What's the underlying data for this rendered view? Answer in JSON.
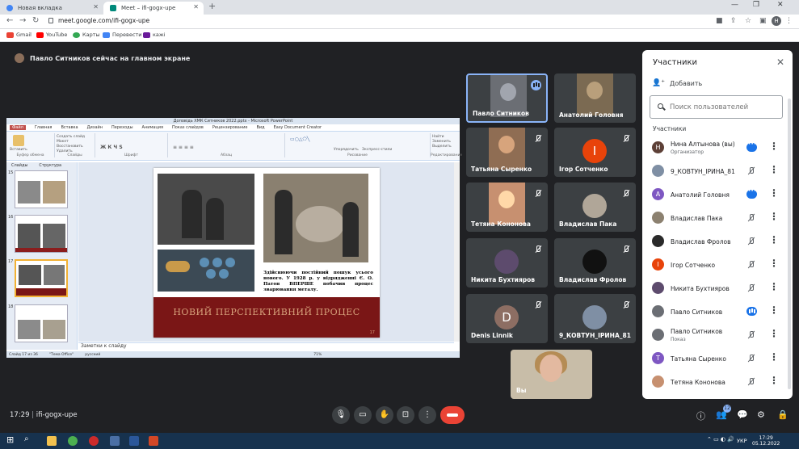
{
  "browser": {
    "tabs": [
      {
        "title": "Новая вкладка",
        "favicon_color": "#4285f4"
      },
      {
        "title": "Meet – ifi-gogx-upe",
        "favicon_color": "#00897b"
      }
    ],
    "new_tab": "+",
    "window": {
      "min": "—",
      "max": "❐",
      "close": "✕"
    },
    "url": "meet.google.com/ifi-gogx-upe",
    "profile_initial": "H",
    "bookmarks": [
      {
        "label": "Gmail",
        "color": "#ea4335"
      },
      {
        "label": "YouTube",
        "color": "#ff0000"
      },
      {
        "label": "Карты",
        "color": "#34a853"
      },
      {
        "label": "Перевести",
        "color": "#4285f4"
      },
      {
        "label": "кажі",
        "color": "#6a1b9a"
      }
    ]
  },
  "meet": {
    "banner": "Павло Ситников сейчас на главном экране",
    "tiles": [
      {
        "name": "Павло Ситников",
        "speaking": true,
        "img": "#6b6e74"
      },
      {
        "name": "Анатолий Головня",
        "img": "#7b6a52"
      },
      {
        "name": "Татьяна Сыренко",
        "img": "#8f6d53"
      },
      {
        "name": "Ігор Сотченко",
        "initial": "І",
        "color": "#e8430a"
      },
      {
        "name": "Тетяна Кононова",
        "img": "#c79070"
      },
      {
        "name": "Владислав Пака",
        "img": "#8c8170"
      },
      {
        "name": "Никита Бухтияров",
        "img": "#5d4b6d"
      },
      {
        "name": "Владислав Фролов",
        "img": "#2a2a2a"
      },
      {
        "name": "Denis Linnik",
        "initial": "D",
        "color": "#8d6e63"
      },
      {
        "name": "9_КОВТУН_ІРИНА_81",
        "img": "#7f8fa4"
      }
    ],
    "self_label": "Вы",
    "clock": "17:29",
    "meeting_code": "ifi-gogx-upe",
    "people_count": "12"
  },
  "ppt": {
    "title": "Доповідь ХМК Ситников 2022.pptx - Microsoft PowerPoint",
    "menu": [
      "Файл",
      "Главная",
      "Вставка",
      "Дизайн",
      "Переходы",
      "Анимация",
      "Показ слайдов",
      "Рецензирование",
      "Вид",
      "Easy Document Creator"
    ],
    "ribbon_groups": [
      "Буфер обмена",
      "Слайды",
      "Шрифт",
      "Абзац",
      "Рисование",
      "Редактирование"
    ],
    "ribbon_items": {
      "paste": "Вставить",
      "create": "Создать слайд",
      "layout": "Макет",
      "reset": "Восстановить",
      "delete": "Удалить",
      "arrange": "Упорядочить",
      "styles": "Экспресс-стили",
      "find": "Найти",
      "replace": "Заменить",
      "select": "Выделить"
    },
    "left_tabs": [
      "Слайды",
      "Структура"
    ],
    "thumbs": [
      "15",
      "16",
      "17",
      "18"
    ],
    "caption": "Здійснюючи постійний пошук усього нового. У 1928 р. у відрядженні Є. О. Патон ВПЕРШЕ побачив процес зварювання металу.",
    "band_title": "НОВИЙ ПЕРСПЕКТИВНИЙ ПРОЦЕС",
    "slide_number": "17",
    "notes_placeholder": "Заметки к слайду",
    "status": {
      "slide": "Слайд 17 из 36",
      "theme": "\"Тема Office\"",
      "lang": "русский",
      "zoom": "71%"
    }
  },
  "panel": {
    "title": "Участники",
    "add": "Добавить",
    "search_placeholder": "Поиск пользователей",
    "section": "Участники",
    "people": [
      {
        "name": "Нина Алтынова (вы)",
        "sub": "Организатор",
        "initial": "Н",
        "color": "#5d4037",
        "state": "dots"
      },
      {
        "name": "9_КОВТУН_ІРИНА_81",
        "initial": "",
        "color": "#7f8fa4",
        "state": "muted"
      },
      {
        "name": "Анатолий Головня",
        "initial": "А",
        "color": "#7e57c2",
        "state": "dots"
      },
      {
        "name": "Владислав Пака",
        "initial": "",
        "color": "#8c8170",
        "state": "muted"
      },
      {
        "name": "Владислав Фролов",
        "initial": "",
        "color": "#2a2a2a",
        "state": "muted"
      },
      {
        "name": "Ігор Сотченко",
        "initial": "І",
        "color": "#e8430a",
        "state": "muted"
      },
      {
        "name": "Никита Бухтияров",
        "initial": "",
        "color": "#5d4b6d",
        "state": "muted"
      },
      {
        "name": "Павло Ситников",
        "initial": "",
        "color": "#6b6e74",
        "state": "speaking"
      },
      {
        "name": "Павло Ситников",
        "sub": "Показ",
        "initial": "",
        "color": "#6b6e74",
        "state": "present"
      },
      {
        "name": "Татьяна Сыренко",
        "initial": "Т",
        "color": "#7e57c2",
        "state": "muted"
      },
      {
        "name": "Тетяна Кононова",
        "initial": "",
        "color": "#c79070",
        "state": "muted"
      }
    ]
  },
  "taskbar": {
    "time": "17:29",
    "date": "05.12.2022",
    "lang": "УКР",
    "apps": [
      {
        "name": "start",
        "color": "#ffffff"
      },
      {
        "name": "search",
        "color": "#ffffff"
      },
      {
        "name": "explorer",
        "color": "#f2c14e"
      },
      {
        "name": "chrome",
        "color": "#4caf50"
      },
      {
        "name": "opera",
        "color": "#cc2b2b"
      },
      {
        "name": "app",
        "color": "#4a6fa5"
      },
      {
        "name": "word",
        "color": "#2b579a"
      },
      {
        "name": "powerpoint",
        "color": "#d24726"
      }
    ]
  }
}
